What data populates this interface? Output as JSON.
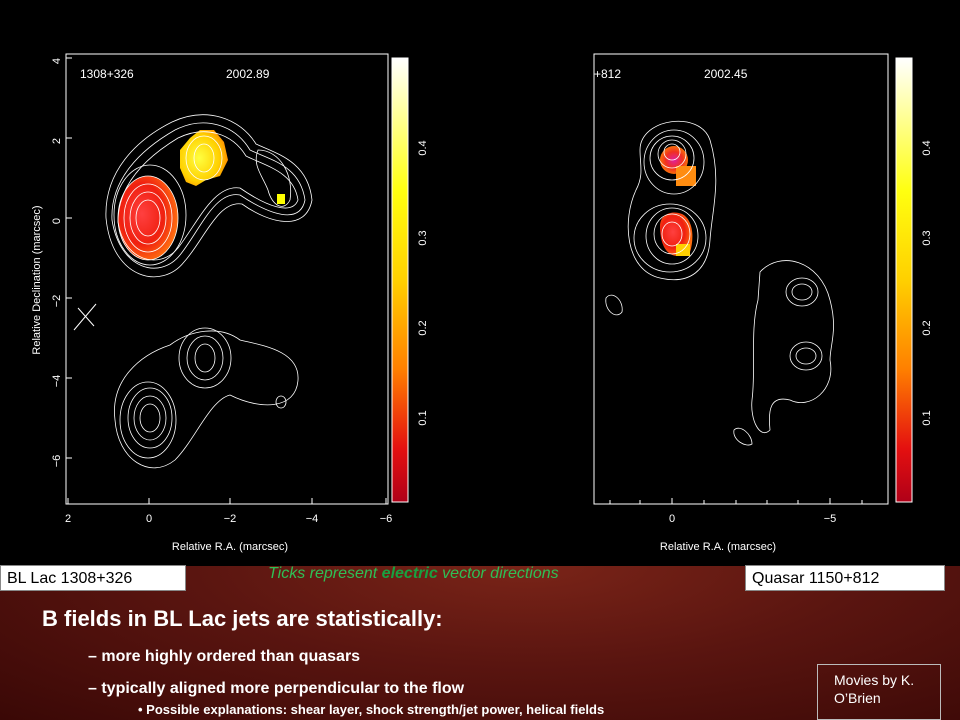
{
  "left_panel": {
    "source": "1308+326",
    "epoch": "2002.89",
    "x_label": "Relative R.A. (marcsec)",
    "y_label": "Relative Declination (marcsec)",
    "x_ticks": [
      "2",
      "0",
      "−2",
      "−4",
      "−6"
    ],
    "y_ticks": [
      "4",
      "2",
      "0",
      "−2",
      "−4",
      "−6"
    ],
    "colorbar_ticks": [
      "0.4",
      "0.3",
      "0.2",
      "0.1"
    ]
  },
  "right_panel": {
    "source": "+812",
    "epoch": "2002.45",
    "x_label": "Relative R.A. (marcsec)",
    "x_ticks": [
      "0",
      "−5"
    ],
    "colorbar_ticks": [
      "0.4",
      "0.3",
      "0.2",
      "0.1"
    ]
  },
  "labels": {
    "left": "BL Lac 1308+326",
    "right": "Quasar 1150+812"
  },
  "caption": {
    "before": "Ticks represent ",
    "emphasis": "electric",
    "after": " vector directions"
  },
  "heading": "B fields in BL Lac jets are statistically:",
  "bullets": [
    "– more highly ordered than quasars",
    "– typically aligned more perpendicular to the flow"
  ],
  "sub_bullet": "• Possible explanations:  shear layer, shock strength/jet power, helical fields",
  "credit": "Movies by K. O’Brien",
  "colors": {
    "contour": "#ffffff",
    "colorbar_high": "#ffffff",
    "colorbar_mid": "#ffff00",
    "colorbar_low": "#cc0000",
    "caption": "#2fbf55"
  }
}
